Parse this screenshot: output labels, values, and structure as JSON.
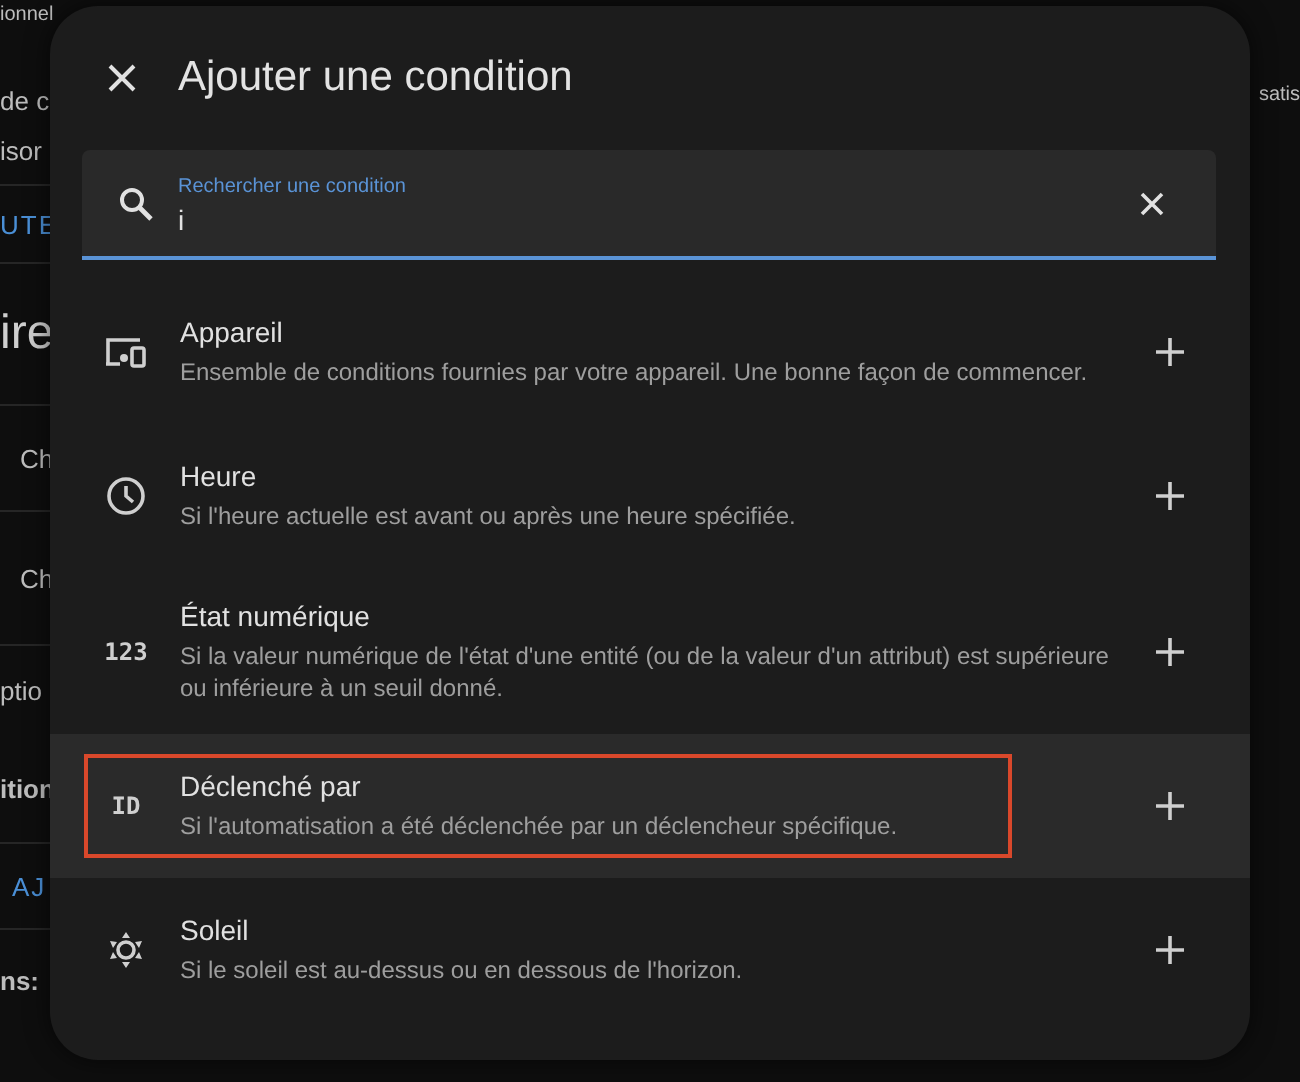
{
  "background_page": {
    "left_fragments": [
      {
        "text": "ionnel",
        "kind": "text"
      },
      {
        "text": "de c",
        "kind": "text"
      },
      {
        "text": "isor",
        "kind": "text"
      },
      {
        "text": "UTE",
        "kind": "link"
      },
      {
        "text": "ire",
        "kind": "heading"
      },
      {
        "text": "Ch",
        "kind": "text"
      },
      {
        "text": "Ch",
        "kind": "text"
      },
      {
        "text": "ptio",
        "kind": "text"
      },
      {
        "text": "ition",
        "kind": "label"
      },
      {
        "text": "AJ",
        "kind": "link"
      },
      {
        "text": "ns:",
        "kind": "label"
      }
    ],
    "right_fragments": [
      {
        "text": "satis",
        "kind": "text"
      }
    ]
  },
  "dialog": {
    "title": "Ajouter une condition",
    "search": {
      "placeholder": "Rechercher une condition",
      "value": "i"
    },
    "items": [
      {
        "title": "Appareil",
        "description": "Ensemble de conditions fournies par votre appareil. Une bonne façon de commencer.",
        "kind": "device",
        "selected": false,
        "annotated": false
      },
      {
        "title": "Heure",
        "description": "Si l'heure actuelle est avant ou après une heure spécifiée.",
        "kind": "clock",
        "selected": false,
        "annotated": false
      },
      {
        "title": "État numérique",
        "description": "Si la valeur numérique de l'état d'une entité (ou de la valeur d'un attribut) est supérieure ou inférieure à un seuil donné.",
        "kind": "number",
        "icon_text": "123",
        "selected": false,
        "annotated": false
      },
      {
        "title": "Déclenché par",
        "description": "Si l'automatisation a été déclenchée par un déclencheur spécifique.",
        "kind": "trigger",
        "icon_text": "ID",
        "selected": true,
        "annotated": true
      },
      {
        "title": "Soleil",
        "description": "Si le soleil est au-dessus ou en dessous de l'horizon.",
        "kind": "sun",
        "selected": false,
        "annotated": false
      }
    ]
  }
}
